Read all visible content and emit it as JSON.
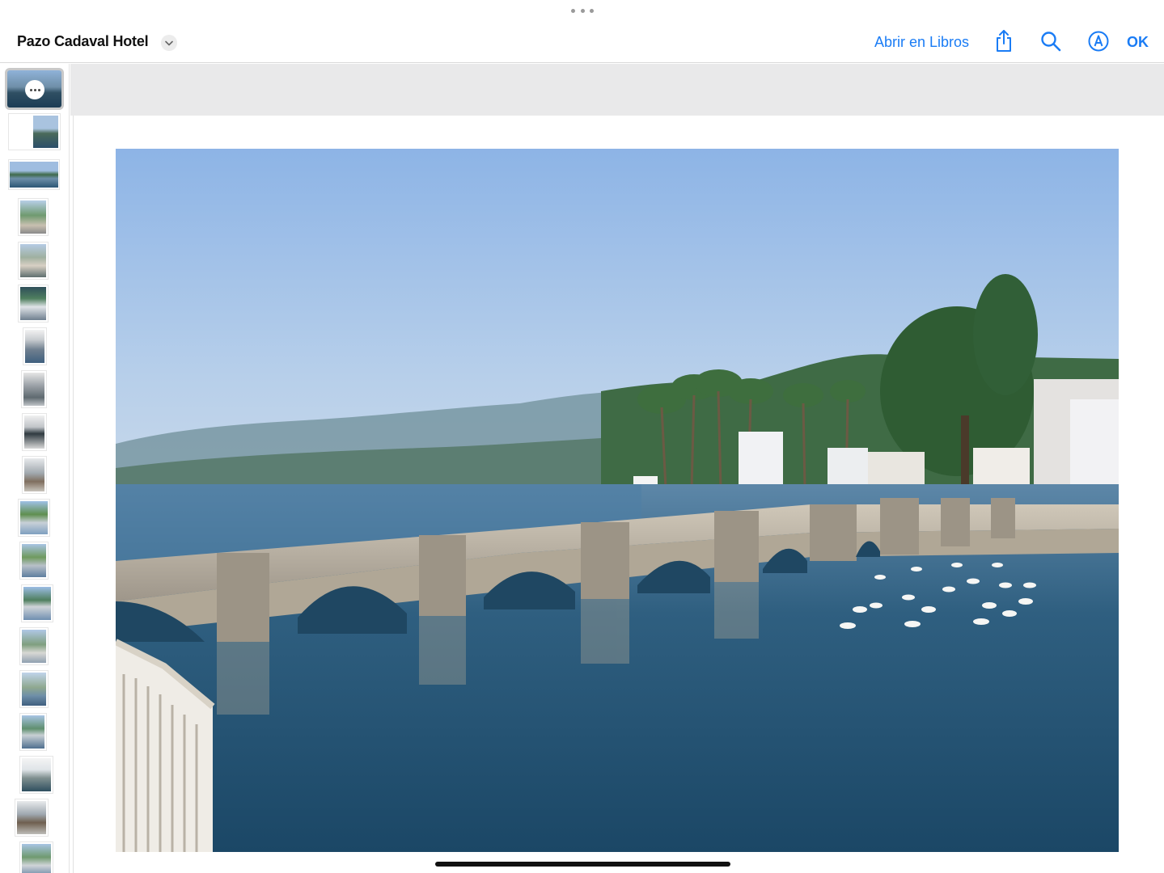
{
  "window": {
    "title": "Pazo Cadaval Hotel"
  },
  "toolbar": {
    "open_in_books_label": "Abrir en Libros",
    "done_label": "OK",
    "share_icon": "share-icon",
    "search_icon": "search-icon",
    "markup_icon": "markup-icon"
  },
  "colors": {
    "accent": "#1a7cf5",
    "title_text": "#111111",
    "viewer_background": "#e9e9ea"
  },
  "sidebar": {
    "thumbnail_count": 19,
    "selected_index": 0,
    "selected_badge_icon": "more-options-icon"
  },
  "photo": {
    "subject_icon": "bridge-river-photo"
  }
}
